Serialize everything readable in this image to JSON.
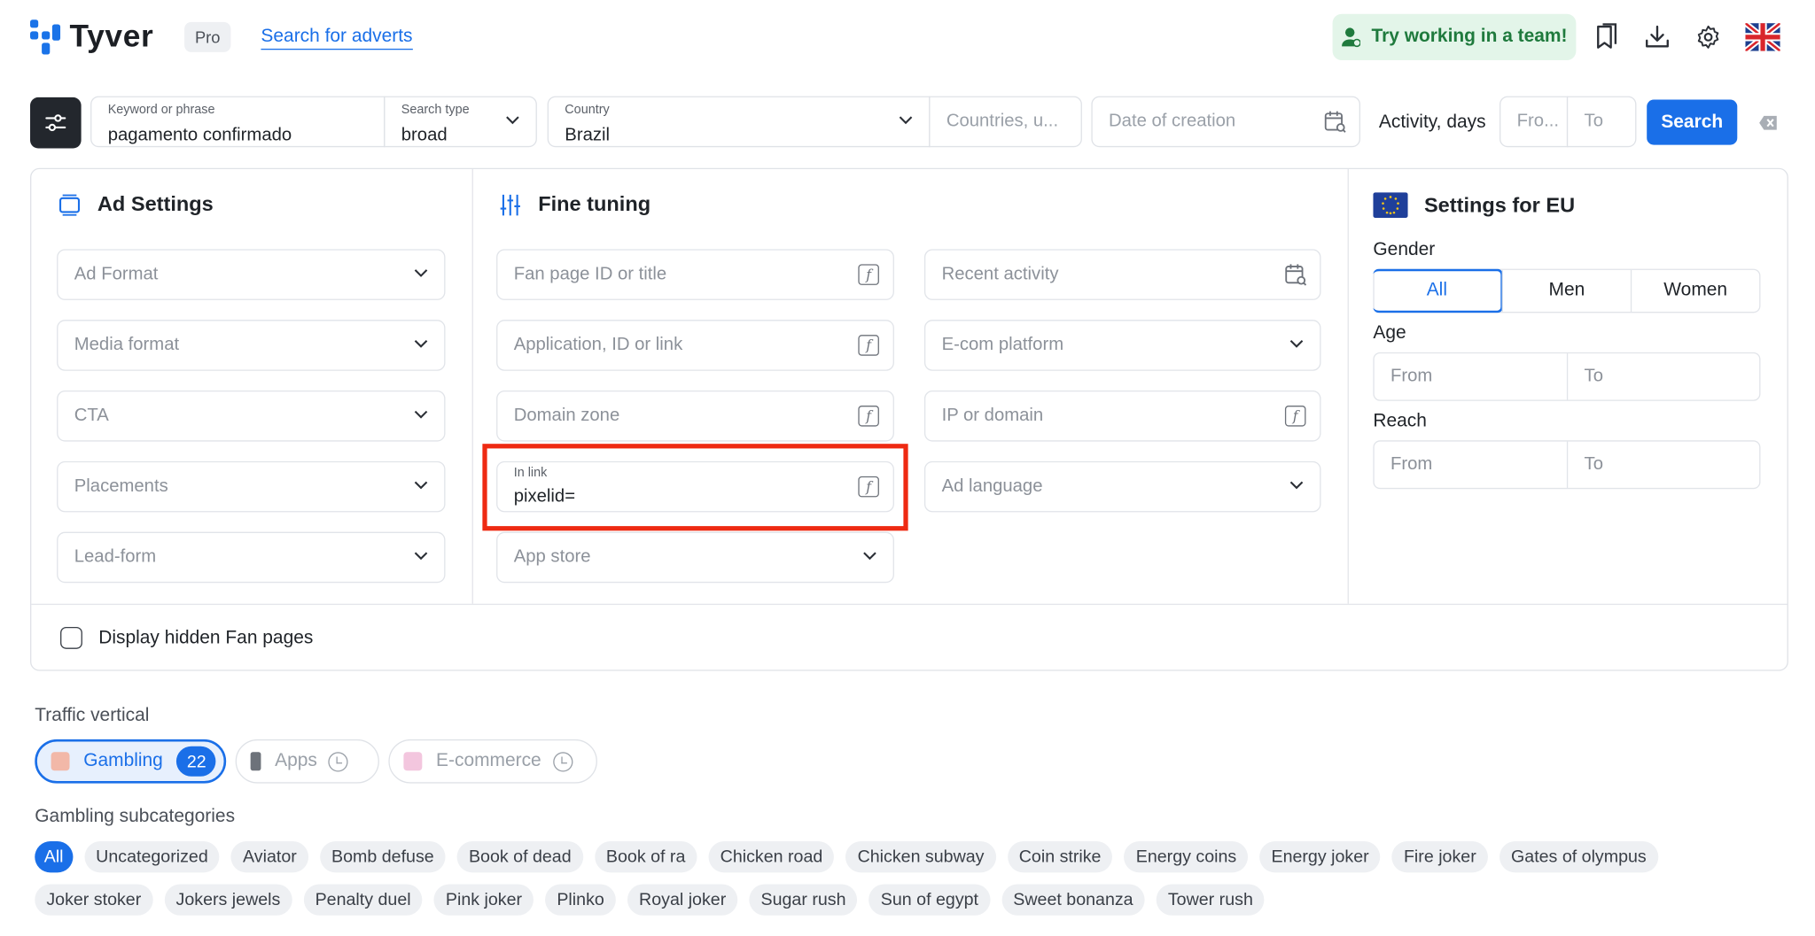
{
  "header": {
    "brand": "Tyver",
    "plan_badge": "Pro",
    "search_link": "Search for adverts",
    "team_button": "Try working in a team!",
    "icons": [
      "bookmarks-icon",
      "download-icon",
      "settings-icon",
      "uk-flag-icon"
    ]
  },
  "search_bar": {
    "keyword": {
      "label": "Keyword or phrase",
      "value": "pagamento confirmado"
    },
    "search_type": {
      "label": "Search type",
      "value": "broad"
    },
    "country": {
      "label": "Country",
      "value": "Brazil"
    },
    "countries_placeholder": "Countries, u...",
    "date_placeholder": "Date of creation",
    "activity_label": "Activity, days",
    "activity_from": "Fro...",
    "activity_to": "To",
    "search_button": "Search"
  },
  "ad_settings": {
    "title": "Ad Settings",
    "fields": [
      "Ad Format",
      "Media format",
      "CTA",
      "Placements",
      "Lead-form"
    ]
  },
  "fine_tuning": {
    "title": "Fine tuning",
    "left": {
      "fan_page": "Fan page ID or title",
      "application": "Application, ID or link",
      "domain_zone": "Domain zone",
      "in_link_label": "In link",
      "in_link_value": "pixelid=",
      "app_store": "App store"
    },
    "right": {
      "recent_activity": "Recent activity",
      "ecom_platform": "E-com platform",
      "ip_domain": "IP or domain",
      "ad_language": "Ad language"
    }
  },
  "eu_settings": {
    "title": "Settings for EU",
    "gender_label": "Gender",
    "gender_options": [
      "All",
      "Men",
      "Women"
    ],
    "gender_selected": "All",
    "age_label": "Age",
    "age_from": "From",
    "age_to": "To",
    "reach_label": "Reach",
    "reach_from": "From",
    "reach_to": "To"
  },
  "hidden_fanpages_label": "Display hidden Fan pages",
  "traffic_vertical": {
    "label": "Traffic vertical",
    "items": [
      {
        "label": "Gambling",
        "count": "22",
        "selected": true
      },
      {
        "label": "Apps",
        "selected": false
      },
      {
        "label": "E-commerce",
        "selected": false
      }
    ]
  },
  "gambling_subcategories": {
    "label": "Gambling subcategories",
    "tags": [
      "All",
      "Uncategorized",
      "Aviator",
      "Bomb defuse",
      "Book of dead",
      "Book of ra",
      "Chicken road",
      "Chicken subway",
      "Coin strike",
      "Energy coins",
      "Energy joker",
      "Fire joker",
      "Gates of olympus",
      "Joker stoker",
      "Jokers jewels",
      "Penalty duel",
      "Pink joker",
      "Plinko",
      "Royal joker",
      "Sugar rush",
      "Sun of egypt",
      "Sweet bonanza",
      "Tower rush"
    ],
    "selected": "All"
  },
  "colors": {
    "accent": "#1a6fe8",
    "highlight": "#ee2a12",
    "team_bg": "#e3f5e9"
  }
}
